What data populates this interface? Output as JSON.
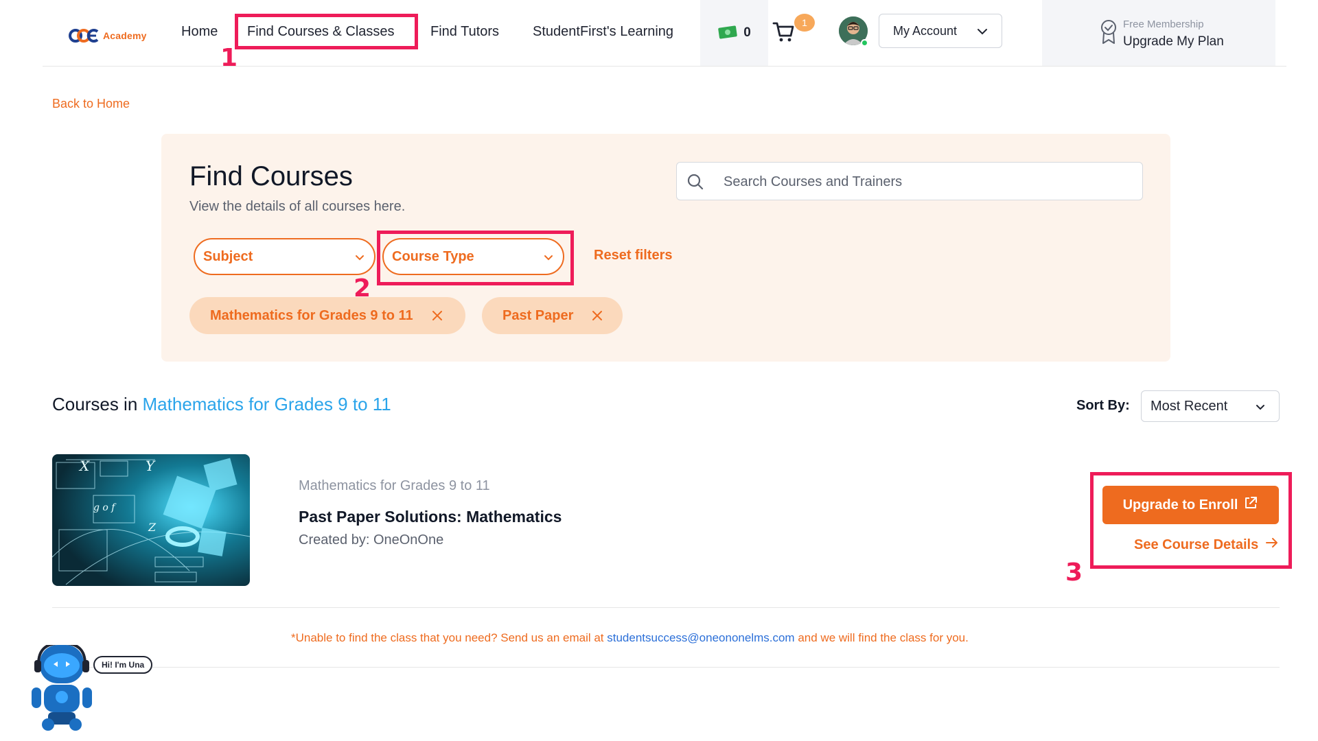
{
  "brand": {
    "logo_letters": "OOE",
    "logo_word": "Academy",
    "accent_color": "#ee6b1f",
    "link_color": "#2aa4ea"
  },
  "nav": {
    "home": "Home",
    "find_courses": "Find Courses & Classes",
    "find_tutors": "Find Tutors",
    "learning": "StudentFirst's Learning",
    "wallet_count": "0",
    "cart_badge": "1",
    "account": "My Account",
    "plan_caption": "Free Membership",
    "plan_action": "Upgrade My Plan"
  },
  "back_link": "Back to Home",
  "filter_panel": {
    "title": "Find Courses",
    "subtitle": "View the details of all courses here.",
    "search_placeholder": "Search Courses and Trainers",
    "subject_select": "Subject",
    "course_type_select": "Course Type",
    "reset": "Reset filters",
    "active_filters": [
      "Mathematics for Grades 9 to 11",
      "Past Paper"
    ]
  },
  "results": {
    "heading_prefix": "Courses in",
    "heading_subject": "Mathematics for Grades 9 to 11",
    "sort_label": "Sort By:",
    "sort_value": "Most Recent"
  },
  "course": {
    "subject": "Mathematics for Grades 9 to 11",
    "title": "Past Paper Solutions: Mathematics",
    "created_by": "Created by: OneOnOne",
    "enroll_label": "Upgrade to Enroll",
    "details_label": "See Course Details"
  },
  "footnote": {
    "before": "*Unable to find the class that you need? Send us an email at ",
    "email": "studentsuccess@oneononelms.com",
    "after": " and we will find the class for you."
  },
  "chatbot": {
    "greeting": "Hi! I'm Una"
  },
  "annotations": [
    "1",
    "2",
    "3"
  ],
  "annotation_color": "#ee1c59"
}
